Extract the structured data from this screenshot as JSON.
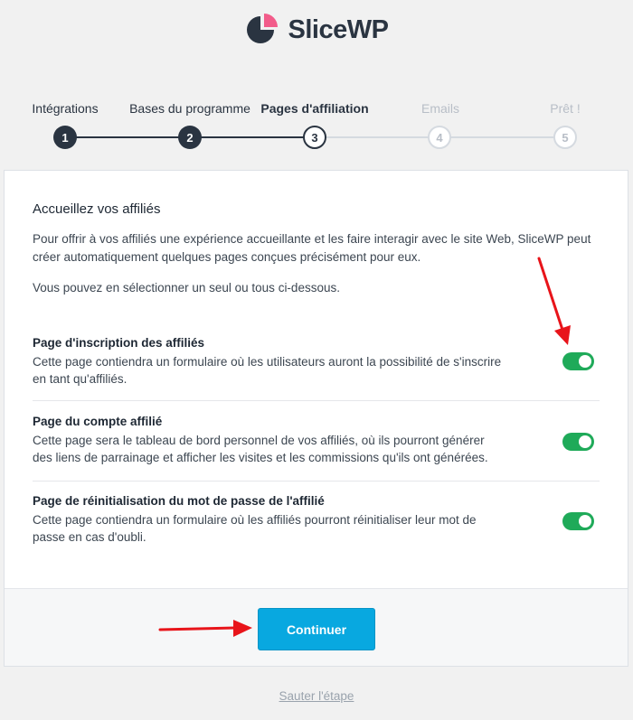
{
  "brand": {
    "name": "SliceWP",
    "colors": {
      "dark": "#2a3441",
      "pink": "#f25c8a"
    }
  },
  "steps": [
    {
      "label": "Intégrations",
      "number": "1",
      "state": "done"
    },
    {
      "label": "Bases du programme",
      "number": "2",
      "state": "done"
    },
    {
      "label": "Pages d'affiliation",
      "number": "3",
      "state": "current"
    },
    {
      "label": "Emails",
      "number": "4",
      "state": "future"
    },
    {
      "label": "Prêt !",
      "number": "5",
      "state": "future"
    }
  ],
  "card": {
    "title": "Accueillez vos affiliés",
    "intro_1": "Pour offrir à vos affiliés une expérience accueillante et les faire interagir avec le site Web, SliceWP peut créer automatiquement quelques pages conçues précisément pour eux.",
    "intro_2": "Vous pouvez en sélectionner un seul ou tous ci-dessous.",
    "options": [
      {
        "title": "Page d'inscription des affiliés",
        "description": "Cette page contiendra un formulaire où les utilisateurs auront la possibilité de s'inscrire en tant qu'affiliés.",
        "enabled": true
      },
      {
        "title": "Page du compte affilié",
        "description": "Cette page sera le tableau de bord personnel de vos affiliés, où ils pourront générer des liens de parrainage et afficher les visites et les commissions qu'ils ont générées.",
        "enabled": true
      },
      {
        "title": "Page de réinitialisation du mot de passe de l'affilié",
        "description": "Cette page contiendra un formulaire où les affiliés pourront réinitialiser leur mot de passe en cas d'oubli.",
        "enabled": true
      }
    ],
    "continue_label": "Continuer"
  },
  "skip_label": "Sauter l'étape",
  "colors": {
    "toggle_on": "#1faa59",
    "button": "#08a8e0",
    "annotation_arrow": "#e8141a"
  }
}
